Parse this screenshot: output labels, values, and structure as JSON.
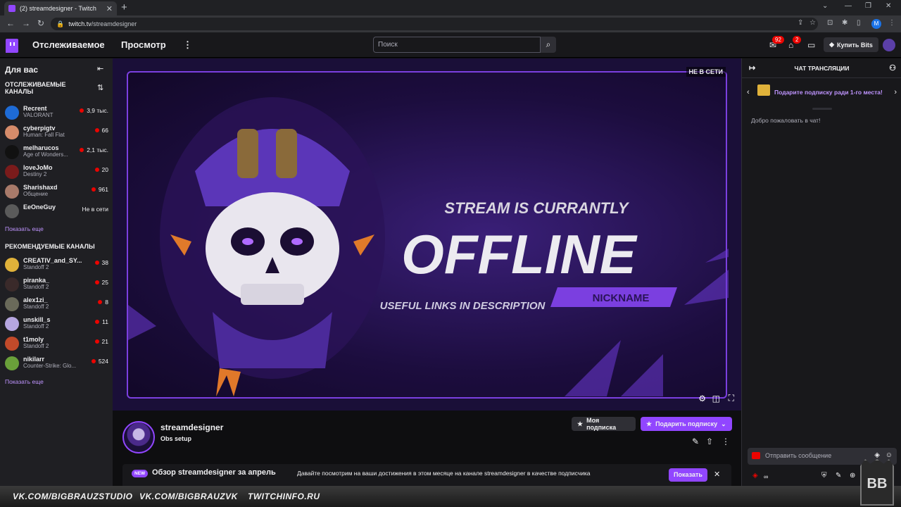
{
  "browser": {
    "tab_title": "(2) streamdesigner - Twitch",
    "url_host": "twitch.tv",
    "url_path": "/streamdesigner",
    "profile_letter": "M"
  },
  "nav": {
    "following": "Отслеживаемое",
    "browse": "Просмотр",
    "search_placeholder": "Поиск",
    "inbox_count": "92",
    "whispers_count": "2",
    "bits_label": "Купить Bits"
  },
  "sidebar": {
    "for_you": "Для вас",
    "followed_header": "ОТСЛЕЖИВАЕМЫЕ КАНАЛЫ",
    "followed": [
      {
        "name": "Recrent",
        "game": "VALORANT",
        "viewers": "3,9 тыс.",
        "avatar_color": "#1e6bd6"
      },
      {
        "name": "cyberpigtv",
        "game": "Human: Fall Flat",
        "viewers": "66",
        "avatar_color": "#d58b6a"
      },
      {
        "name": "melharucos",
        "game": "Age of Wonders...",
        "viewers": "2,1 тыс.",
        "avatar_color": "#111111"
      },
      {
        "name": "loveJoMo",
        "game": "Destiny 2",
        "viewers": "20",
        "avatar_color": "#7a1b1b"
      },
      {
        "name": "Sharishaxd",
        "game": "Общение",
        "viewers": "961",
        "avatar_color": "#a87a6a"
      },
      {
        "name": "EeOneGuy",
        "game": "",
        "viewers": "Не в сети",
        "avatar_color": "#5a5a5a"
      }
    ],
    "show_more": "Показать еще",
    "recommended_header": "РЕКОМЕНДУЕМЫЕ КАНАЛЫ",
    "recommended": [
      {
        "name": "CREATIV_and_SY...",
        "game": "Standoff 2",
        "viewers": "38",
        "avatar_color": "#e0b23a"
      },
      {
        "name": "piranka_",
        "game": "Standoff 2",
        "viewers": "25",
        "avatar_color": "#3a2a2a"
      },
      {
        "name": "alex1zi_",
        "game": "Standoff 2",
        "viewers": "8",
        "avatar_color": "#6a6a5a"
      },
      {
        "name": "unskill_s",
        "game": "Standoff 2",
        "viewers": "11",
        "avatar_color": "#b6a6e0"
      },
      {
        "name": "t1moly",
        "game": "Standoff 2",
        "viewers": "21",
        "avatar_color": "#c24a2a"
      },
      {
        "name": "nikilarr",
        "game": "Counter-Strike: Glo...",
        "viewers": "524",
        "avatar_color": "#6aa03a"
      }
    ],
    "show_more_2": "Показать еще"
  },
  "player": {
    "offline_tag": "НЕ В СЕТИ",
    "line1": "STREAM IS CURRANTLY",
    "line2": "OFFLINE",
    "line3": "USEFUL LINKS IN DESCRIPTION",
    "nickname": "NICKNAME"
  },
  "channel": {
    "name": "streamdesigner",
    "title": "Obs setup",
    "my_sub": "Моя подписка",
    "gift_sub": "Подарить подписку"
  },
  "promo": {
    "badge": "NEW",
    "title": "Обзор streamdesigner за апрель",
    "desc": "Давайте посмотрим на ваши достижения в этом месяце на канале streamdesigner в качестве подписчика",
    "show": "Показать"
  },
  "chat": {
    "header": "ЧАТ ТРАНСЛЯЦИИ",
    "gift_text": "Подарите подписку ради 1-го места!",
    "welcome": "Добро пожаловать в чат!",
    "input_placeholder": "Отправить сообщение",
    "points": "∞"
  },
  "watermark": {
    "a": "VK.COM/BIGBRAUZSTUDIO",
    "b": "VK.COM/BIGBRAUZVK",
    "c": "TWITCHINFO.RU",
    "logo": "BB"
  },
  "colors": {
    "accent": "#9146ff",
    "live": "#eb0400"
  }
}
